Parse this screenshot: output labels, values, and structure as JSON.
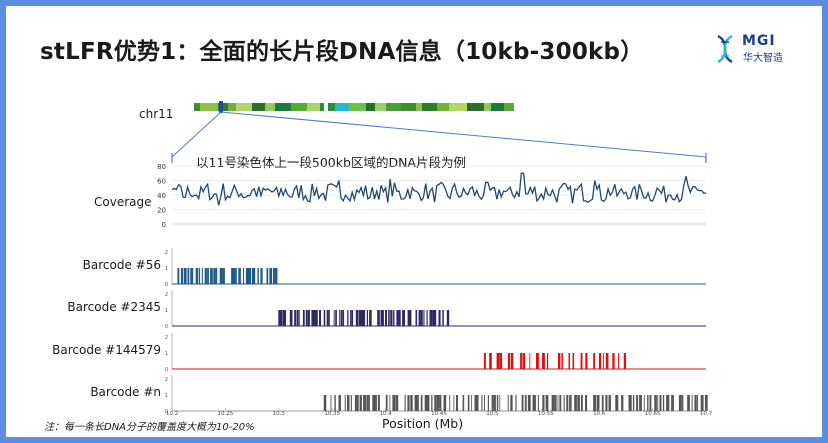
{
  "title": "stLFR优势1：全面的长片段DNA信息（10kb-300kb）",
  "logo": {
    "text": "MGI",
    "subtitle": "华大智造",
    "icon": "dna-helix-icon"
  },
  "chromosome": {
    "label": "chr11"
  },
  "caption": "以11号染色体上一段500kb区域的DNA片段为例",
  "coverage_label": "Coverage",
  "x_axis_label": "Position (Mb)",
  "note": "注：每一条长DNA分子的覆盖度大概为10-20%",
  "barcodes": [
    {
      "label": "Barcode #56",
      "color": "#1f5a86"
    },
    {
      "label": "Barcode #2345",
      "color": "#2d2a62"
    },
    {
      "label": "Barcode #144579",
      "color": "#e00f0f"
    },
    {
      "label": "Barcode #n",
      "color": "#555555"
    }
  ],
  "chart_data": {
    "type": "line",
    "title": "",
    "xlabel": "Position (Mb)",
    "ylabel": "Coverage",
    "xlim": [
      10.2,
      10.7
    ],
    "x_ticks": [
      "10.2",
      "10.25",
      "10.3",
      "10.35",
      "10.4",
      "10.45",
      "10.5",
      "10.55",
      "10.6",
      "10.65",
      "10.7"
    ],
    "coverage": {
      "ylim": [
        0,
        80
      ],
      "y_ticks": [
        "0",
        "20",
        "40",
        "60",
        "80"
      ],
      "baseline": 43,
      "amplitude": 12,
      "peaks": [
        [
          10.243,
          26
        ],
        [
          10.357,
          60
        ],
        [
          10.405,
          62
        ],
        [
          10.528,
          70
        ],
        [
          10.595,
          60
        ],
        [
          10.682,
          66
        ]
      ]
    },
    "barcode_tracks": {
      "ylim": [
        0,
        2
      ],
      "y_ticks": [
        "0",
        "1",
        "2"
      ],
      "series": [
        {
          "name": "Barcode #56",
          "start": 10.204,
          "end": 10.298,
          "count": 34
        },
        {
          "name": "Barcode #2345",
          "start": 10.298,
          "end": 10.458,
          "count": 62
        },
        {
          "name": "Barcode #144579",
          "start": 10.491,
          "end": 10.627,
          "count": 26
        },
        {
          "name": "Barcode #n",
          "start": 10.342,
          "end": 10.7,
          "count": 120
        }
      ]
    }
  },
  "ideogram_bands": [
    "#3f8f2e",
    "#8cc24a",
    "#2e7d2e",
    "#6fb03a",
    "#b2d66a",
    "#2d6e2a",
    "#93c85a",
    "#1f7a3c",
    "#56a83a",
    "#a7d36a",
    "#2f8a3a",
    "#2cb7c9",
    "#6ec04a",
    "#246e2f",
    "#9bd06a",
    "#4a9d38"
  ]
}
